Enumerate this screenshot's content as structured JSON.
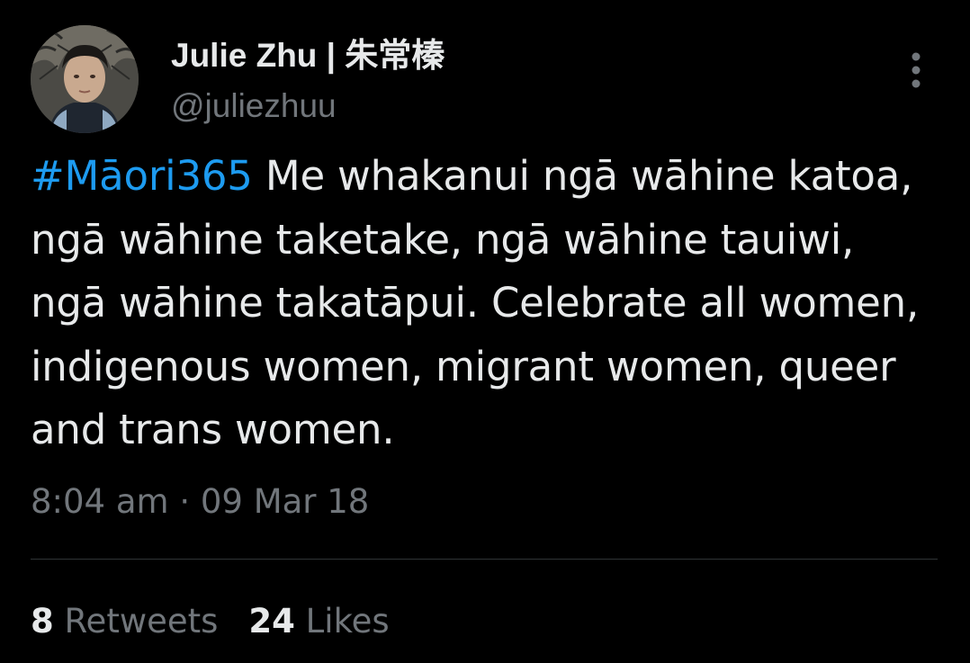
{
  "author": {
    "display_name": "Julie Zhu | 朱常榛",
    "handle": "@juliezhuu"
  },
  "tweet": {
    "hashtag": "#Māori365",
    "body": " Me whakanui ngā wāhine katoa, ngā wāhine taketake, ngā wāhine tauiwi, ngā wāhine takatāpui. Celebrate all women, indigenous women, migrant women, queer and trans women.",
    "timestamp": "8:04 am · 09 Mar 18"
  },
  "stats": {
    "retweets_count": "8",
    "retweets_label": "Retweets",
    "likes_count": "24",
    "likes_label": "Likes"
  },
  "icons": {
    "more": "vertical-ellipsis-icon"
  },
  "colors": {
    "background": "#000000",
    "primary_text": "#e7e9ea",
    "secondary_text": "#71767b",
    "link": "#1d9bf0",
    "divider": "#2f3336"
  }
}
